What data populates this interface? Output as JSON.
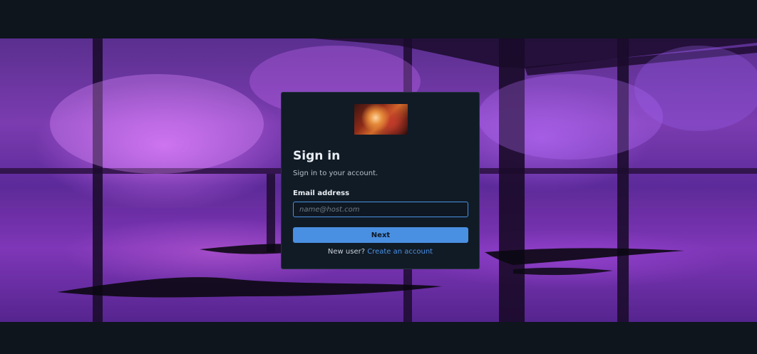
{
  "login": {
    "title": "Sign in",
    "subtitle": "Sign in to your account.",
    "email_label": "Email address",
    "email_value": "",
    "email_placeholder": "name@host.com",
    "next_label": "Next",
    "new_user_text": "New user?",
    "create_account_label": "Create an account"
  },
  "colors": {
    "accent": "#4a90e2",
    "card_background": "#111b26",
    "page_background": "#0e151c"
  }
}
